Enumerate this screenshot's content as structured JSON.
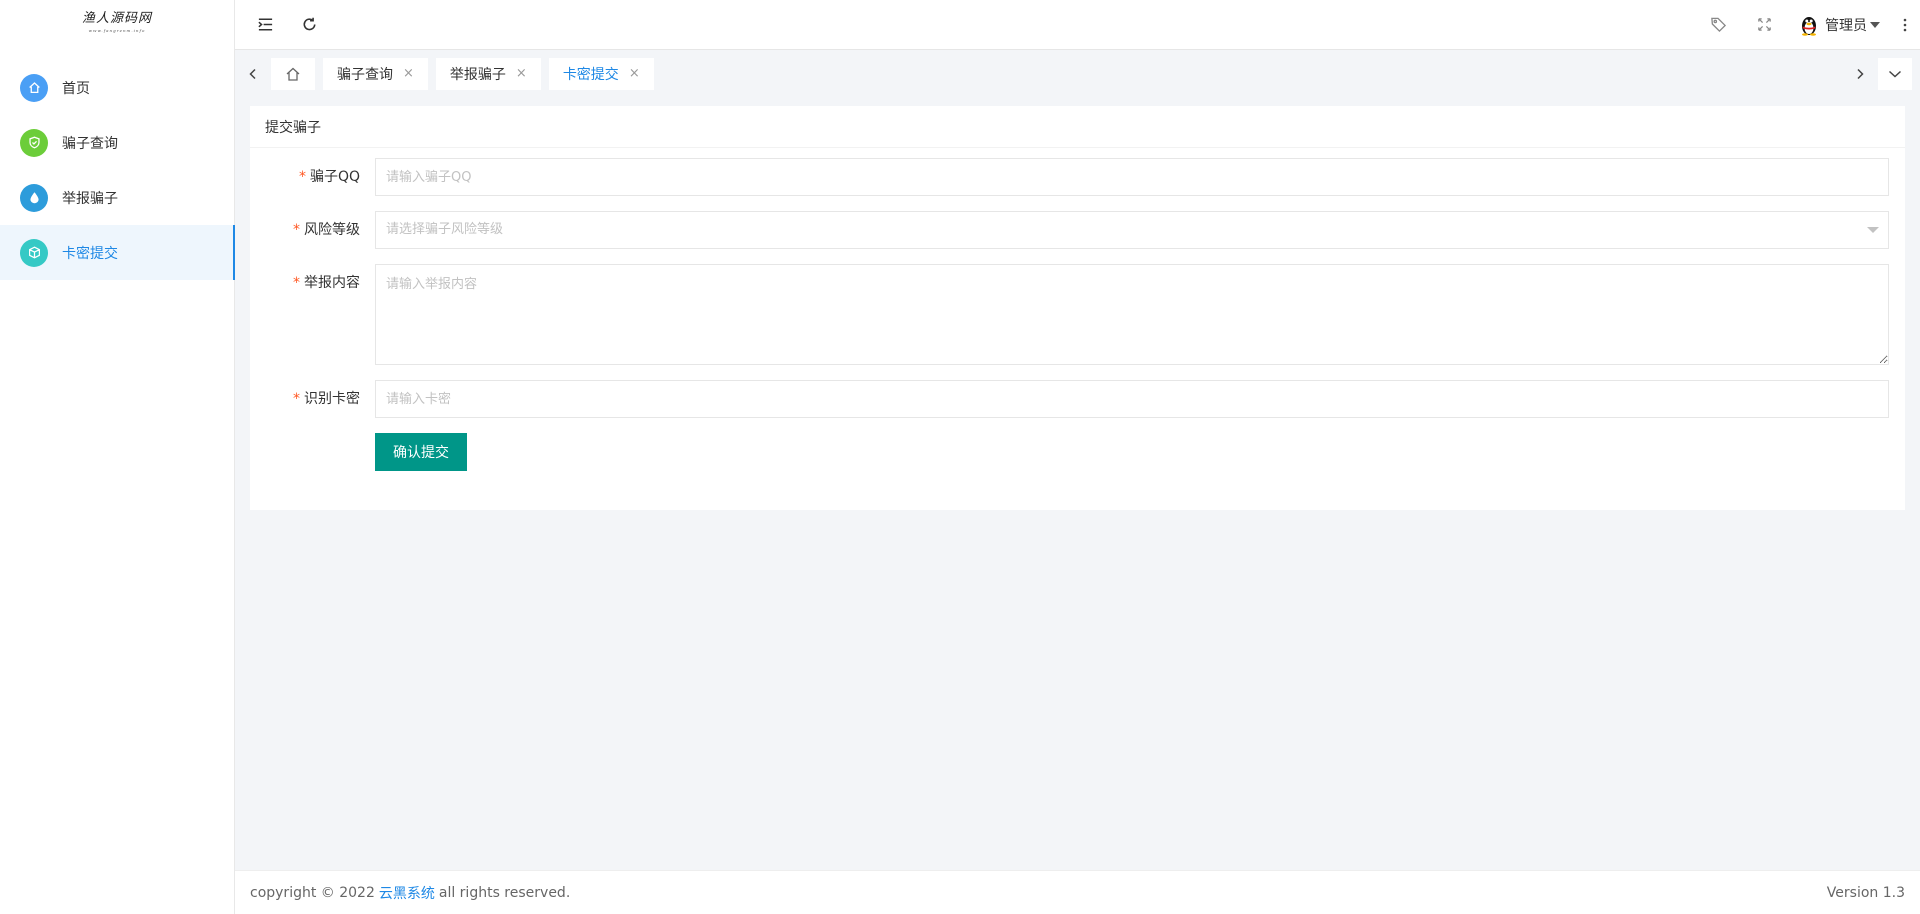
{
  "logo": {
    "text": "渔人源码网",
    "sub": "www.fangrenm.info"
  },
  "sidebar": {
    "items": [
      {
        "label": "首页",
        "icon": "home-icon",
        "color": "#4a9ff5"
      },
      {
        "label": "骗子查询",
        "icon": "shield-check-icon",
        "color": "#6ccd3a"
      },
      {
        "label": "举报骗子",
        "icon": "drop-icon",
        "color": "#2d9cdb"
      },
      {
        "label": "卡密提交",
        "icon": "cube-icon",
        "color": "#35c9c5",
        "active": true
      }
    ]
  },
  "header": {
    "user_name": "管理员"
  },
  "tabs": [
    {
      "label": "骗子查询",
      "active": false
    },
    {
      "label": "举报骗子",
      "active": false
    },
    {
      "label": "卡密提交",
      "active": true
    }
  ],
  "tab_close": "×",
  "card": {
    "title": "提交骗子",
    "fields": {
      "qq": {
        "label": "骗子QQ",
        "placeholder": "请输入骗子QQ"
      },
      "risk": {
        "label": "风险等级",
        "placeholder": "请选择骗子风险等级"
      },
      "content": {
        "label": "举报内容",
        "placeholder": "请输入举报内容"
      },
      "card_code": {
        "label": "识别卡密",
        "placeholder": "请输入卡密"
      }
    },
    "required_mark": "*",
    "submit_label": "确认提交"
  },
  "footer": {
    "copyright_prefix": "copyright © 2022",
    "brand": "云黑系统",
    "copyright_suffix": "all rights reserved.",
    "version": "Version 1.3"
  },
  "colors": {
    "accent": "#1e88e5",
    "submit": "#009688",
    "required": "#ff5722"
  }
}
